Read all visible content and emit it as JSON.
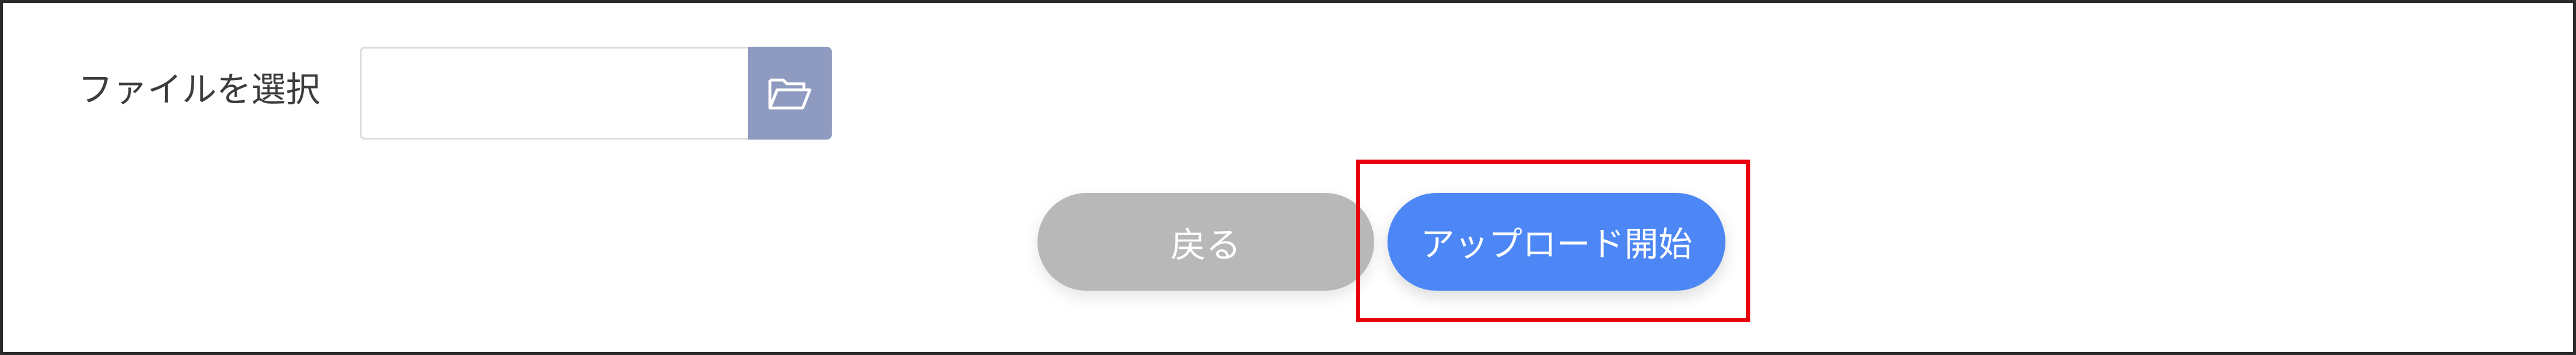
{
  "form": {
    "file_label": "ファイルを選択",
    "file_value": "",
    "browse_icon": "folder-open-icon"
  },
  "actions": {
    "back_label": "戻る",
    "upload_label": "アップロード開始"
  },
  "colors": {
    "browse_button": "#8e9abf",
    "back_button": "#b8b8b8",
    "upload_button": "#4d87f5",
    "highlight": "#e8000d"
  }
}
